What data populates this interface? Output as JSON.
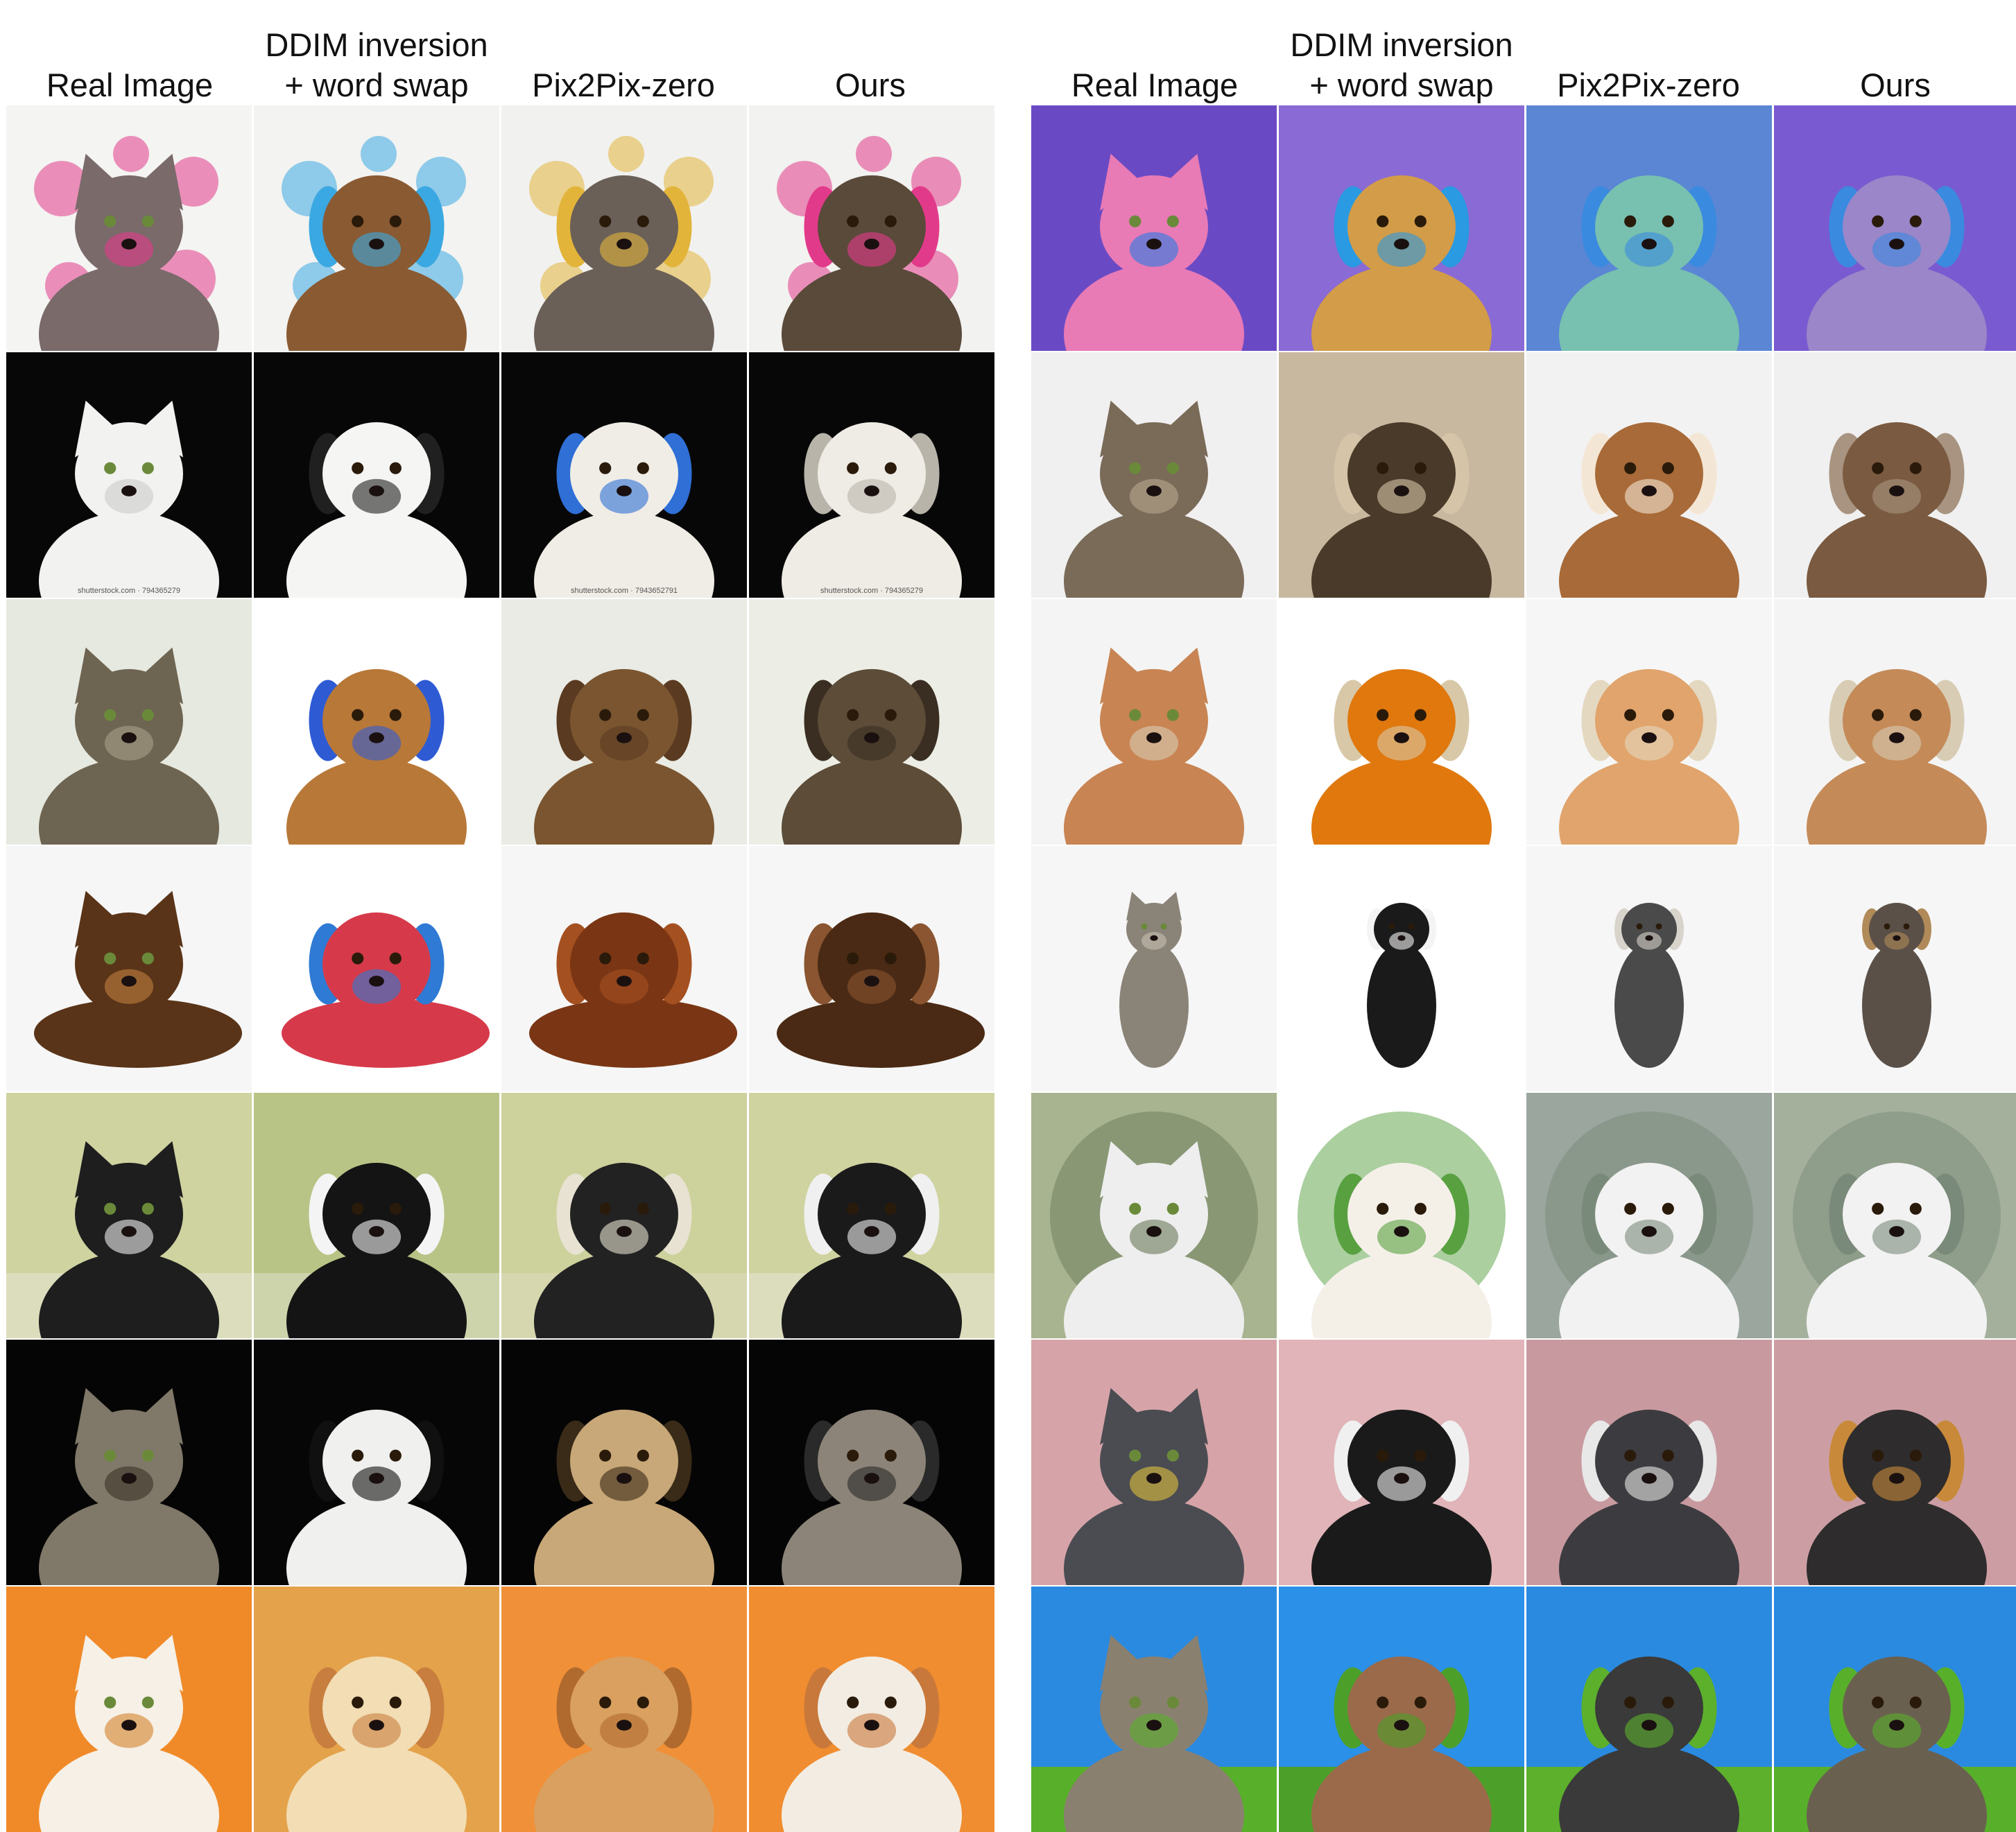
{
  "headers": [
    {
      "lines": [
        "Real Image"
      ]
    },
    {
      "lines": [
        "DDIM inversion",
        "+ word swap"
      ]
    },
    {
      "lines": [
        "Pix2Pix-zero"
      ]
    },
    {
      "lines": [
        "Ours"
      ]
    }
  ],
  "panels": [
    {
      "rows": [
        {
          "bg": [
            "#f4f4f2",
            "#f3f3f1",
            "#f1f1ef",
            "#f2f2f0"
          ],
          "fg": [
            "#7a6a6a",
            "#8a5a32",
            "#6a6058",
            "#5a4a3a"
          ],
          "accent": [
            "#e23a8a",
            "#3aa8e2",
            "#e2b43a",
            "#e23a8a"
          ],
          "kind": "splash"
        },
        {
          "bg": [
            "#070707",
            "#070707",
            "#070707",
            "#070707"
          ],
          "fg": [
            "#f2f2f0",
            "#f5f5f3",
            "#f0ede6",
            "#efece5"
          ],
          "accent": [
            "#cccccc",
            "#202020",
            "#2f6fd6",
            "#b9b4aa"
          ],
          "kind": "portrait",
          "watermark": [
            "shutterstock.com · 794365279",
            "",
            "shutterstock.com · 7943652791",
            "shutterstock.com · 794365279"
          ]
        },
        {
          "bg": [
            "#e6e9df",
            "#ffffff",
            "#e9ebe4",
            "#eceee6"
          ],
          "fg": [
            "#6e6452",
            "#b87838",
            "#7a5530",
            "#5c4c38"
          ],
          "accent": [
            "#a8a08a",
            "#2e5bd4",
            "#5a3a20",
            "#3a2e22"
          ],
          "kind": "portrait"
        },
        {
          "bg": [
            "#f6f6f6",
            "#ffffff",
            "#f6f6f6",
            "#f6f6f6"
          ],
          "fg": [
            "#5a3418",
            "#d63a4a",
            "#7a3614",
            "#4a2a14"
          ],
          "accent": [
            "#c08040",
            "#2e7ad4",
            "#a55020",
            "#8a5530"
          ],
          "kind": "lying"
        },
        {
          "bg": [
            "#cfd3a0",
            "#b8c486",
            "#cdd19c",
            "#cfd3a0"
          ],
          "fg": [
            "#1e1e1e",
            "#141414",
            "#222222",
            "#1a1a1a"
          ],
          "accent": [
            "#f0f0f0",
            "#f4f4f4",
            "#e8e2d2",
            "#f0f0f0"
          ],
          "kind": "grass"
        },
        {
          "bg": [
            "#050505",
            "#060606",
            "#050505",
            "#050505"
          ],
          "fg": [
            "#807868",
            "#f0f0ee",
            "#c8a878",
            "#8c8478"
          ],
          "accent": [
            "#3a3428",
            "#101010",
            "#3a2a18",
            "#2a2a2a"
          ],
          "kind": "portrait"
        },
        {
          "bg": [
            "#f08a28",
            "#e4a24a",
            "#f09038",
            "#f08d30"
          ],
          "fg": [
            "#f6f0e6",
            "#f2ddb4",
            "#d9a060",
            "#f3ece2"
          ],
          "accent": [
            "#d4822c",
            "#c87e3e",
            "#b06a2e",
            "#c8783a"
          ],
          "kind": "portrait"
        }
      ]
    },
    {
      "rows": [
        {
          "bg": [
            "#6a4ac4",
            "#8a6ad4",
            "#5a86d4",
            "#7a5ad0"
          ],
          "fg": [
            "#e87ab6",
            "#d29c48",
            "#78c0b0",
            "#9a86c8"
          ],
          "accent": [
            "#2a7ae2",
            "#2a9ae2",
            "#3a8ae0",
            "#3a8ae0"
          ],
          "kind": "portrait"
        },
        {
          "bg": [
            "#f0f0f0",
            "#c8b8a0",
            "#f2f2f2",
            "#f0f0f0"
          ],
          "fg": [
            "#7a6a58",
            "#4a3a2a",
            "#a86a38",
            "#7a5a40"
          ],
          "accent": [
            "#b8a890",
            "#d6c4a8",
            "#f4e6d4",
            "#a89480"
          ],
          "kind": "portrait"
        },
        {
          "bg": [
            "#f4f4f4",
            "#ffffff",
            "#f6f6f6",
            "#f4f4f4"
          ],
          "fg": [
            "#c88452",
            "#e0780e",
            "#e0a46c",
            "#c48a58"
          ],
          "accent": [
            "#d8ccb4",
            "#d8c8a8",
            "#e4d8c0",
            "#d8ccb4"
          ],
          "kind": "portrait"
        },
        {
          "bg": [
            "#f6f6f6",
            "#ffffff",
            "#f6f6f6",
            "#f6f6f6"
          ],
          "fg": [
            "#8a8478",
            "#1a1a1a",
            "#4a4a4a",
            "#5a5048"
          ],
          "accent": [
            "#c8c0b0",
            "#f4f4f4",
            "#d8d4cc",
            "#b08a58"
          ],
          "kind": "sitting"
        },
        {
          "bg": [
            "#a8b490",
            "#ffffff",
            "#9aa69e",
            "#a4b09c"
          ],
          "fg": [
            "#eeeeee",
            "#f4f0e8",
            "#f2f2f2",
            "#f2f2f2"
          ],
          "accent": [
            "#6a7a5a",
            "#58a040",
            "#7a8a7a",
            "#7a8a7a"
          ],
          "kind": "round"
        },
        {
          "bg": [
            "#d6a4a8",
            "#e0b4b8",
            "#c89aa0",
            "#cc9ea4"
          ],
          "fg": [
            "#4a4c52",
            "#1a1a1a",
            "#3c3c40",
            "#2e2c2c"
          ],
          "accent": [
            "#e0c040",
            "#f0f0f0",
            "#e8e8e8",
            "#c88a3a"
          ],
          "kind": "portrait"
        },
        {
          "bg": [
            "#2a8ae0",
            "#2a90e8",
            "#2a8ae0",
            "#2a8ae0"
          ],
          "fg": [
            "#8a8070",
            "#9a6a4a",
            "#3a3a3a",
            "#6a6050"
          ],
          "accent": [
            "#58b02a",
            "#4ca02a",
            "#5cb02c",
            "#58b02a"
          ],
          "kind": "field"
        }
      ]
    }
  ]
}
